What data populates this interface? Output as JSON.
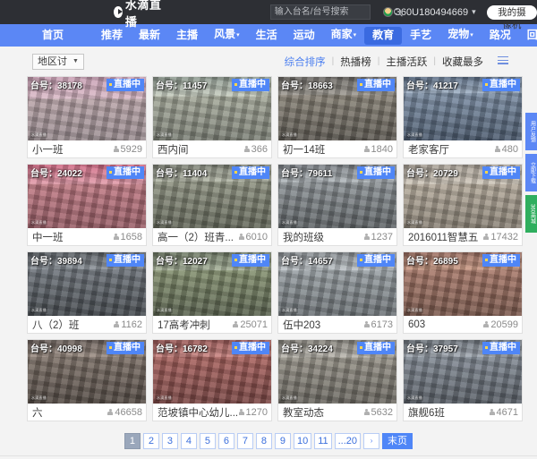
{
  "header": {
    "logo_text": "水滴直播",
    "logo_icon": "water-drop-play-icon",
    "search_placeholder": "输入台名/台号搜索",
    "search_value": "",
    "search_icon": "search-icon",
    "username": "360U180494669",
    "user_caret": "▾",
    "camera_button": "我的摄像机"
  },
  "nav": {
    "items": [
      {
        "label": "首页",
        "caret": "",
        "active": false
      },
      {
        "label": "推荐",
        "caret": "",
        "active": false
      },
      {
        "label": "最新",
        "caret": "",
        "active": false
      },
      {
        "label": "主播",
        "caret": "",
        "active": false
      },
      {
        "label": "风景",
        "caret": "▾",
        "active": false
      },
      {
        "label": "生活",
        "caret": "",
        "active": false
      },
      {
        "label": "运动",
        "caret": "",
        "active": false
      },
      {
        "label": "商家",
        "caret": "▾",
        "active": false
      },
      {
        "label": "教育",
        "caret": "",
        "active": true
      },
      {
        "label": "手艺",
        "caret": "",
        "active": false
      },
      {
        "label": "宠物",
        "caret": "▾",
        "active": false
      },
      {
        "label": "路况",
        "caret": "",
        "active": false
      },
      {
        "label": "回放",
        "caret": "",
        "active": false
      }
    ]
  },
  "filterbar": {
    "region_label": "地区讨",
    "region_caret": "▼",
    "sort_links": [
      {
        "label": "综合排序",
        "active": true
      },
      {
        "label": "热播榜",
        "active": false
      },
      {
        "label": "主播活跃",
        "active": false
      },
      {
        "label": "收藏最多",
        "active": false
      }
    ],
    "separator": "|",
    "list_view_icon": "list-view-icon"
  },
  "card_labels": {
    "id_prefix": "台号：",
    "live_badge": "直播中",
    "watermark": "水滴直播"
  },
  "cards": [
    {
      "id": "38178",
      "title": "小一班",
      "viewers": "5929",
      "live": "直播中"
    },
    {
      "id": "11457",
      "title": "西内间",
      "viewers": "366",
      "live": "直播中"
    },
    {
      "id": "18663",
      "title": "初一14班",
      "viewers": "1840",
      "live": "直播中"
    },
    {
      "id": "41217",
      "title": "老家客厅",
      "viewers": "480",
      "live": "直播中"
    },
    {
      "id": "24022",
      "title": "中一班",
      "viewers": "1658",
      "live": "直播中"
    },
    {
      "id": "11404",
      "title": "高一（2）班青...",
      "viewers": "6010",
      "live": "直播中"
    },
    {
      "id": "79611",
      "title": "我的班级",
      "viewers": "1237",
      "live": "直播中"
    },
    {
      "id": "20729",
      "title": "2016011智慧五",
      "viewers": "17432",
      "live": "直播中"
    },
    {
      "id": "39894",
      "title": "八（2）班",
      "viewers": "1162",
      "live": "直播中"
    },
    {
      "id": "12027",
      "title": "17高考冲刺",
      "viewers": "25071",
      "live": "直播中"
    },
    {
      "id": "14657",
      "title": "伍中203",
      "viewers": "6173",
      "live": "直播中"
    },
    {
      "id": "26895",
      "title": "603",
      "viewers": "20599",
      "live": "直播中"
    },
    {
      "id": "40998",
      "title": "六",
      "viewers": "46658",
      "live": "直播中"
    },
    {
      "id": "16782",
      "title": "范坡镇中心幼儿...",
      "viewers": "1270",
      "live": "直播中"
    },
    {
      "id": "34224",
      "title": "教室动态",
      "viewers": "5632",
      "live": "直播中"
    },
    {
      "id": "37957",
      "title": "旗舰6班",
      "viewers": "4671",
      "live": "直播中"
    }
  ],
  "side_rail": [
    {
      "label": "用户反馈",
      "color": "#5b87f5"
    },
    {
      "label": "立即下载",
      "color": "#5b87f5"
    },
    {
      "label": "360商城",
      "color": "#2fae5e"
    }
  ],
  "pagination": {
    "pages": [
      "1",
      "2",
      "3",
      "4",
      "5",
      "6",
      "7",
      "8",
      "9",
      "10",
      "11",
      "...20"
    ],
    "current": "1",
    "next_arrow": "›",
    "last_label": "末页"
  },
  "colors": {
    "nav_blue": "#5b87f5",
    "nav_active_blue": "#3a6ae0",
    "topbar_dark": "#2d2f34",
    "link_blue": "#4a7ef0",
    "page_bg": "#f3f3f3"
  }
}
